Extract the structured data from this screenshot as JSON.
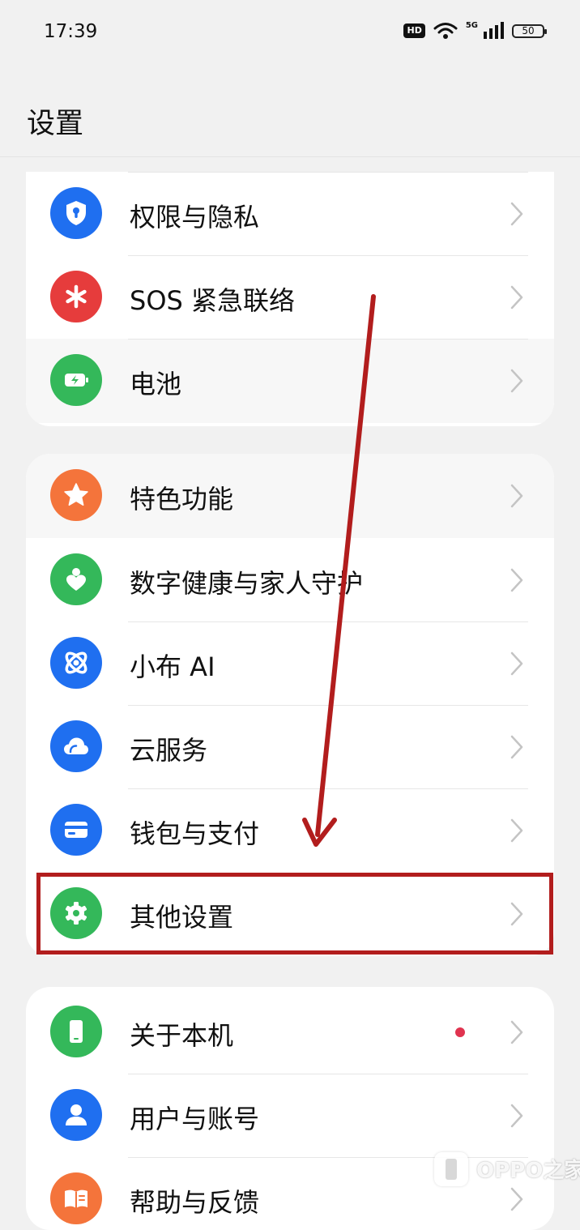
{
  "status_bar": {
    "time": "17:39",
    "hd_badge": "HD",
    "network": "5G",
    "battery_level": "50"
  },
  "header": {
    "title": "设置"
  },
  "groups": [
    {
      "items": [
        {
          "label": "权限与隐私",
          "icon": "shield-lock-icon",
          "color": "#1f6ff0"
        },
        {
          "label": "SOS 紧急联络",
          "icon": "sos-asterisk-icon",
          "color": "#e63c3c"
        },
        {
          "label": "电池",
          "icon": "battery-charging-icon",
          "color": "#34b85a"
        }
      ]
    },
    {
      "items": [
        {
          "label": "特色功能",
          "icon": "star-icon",
          "color": "#f4743b"
        },
        {
          "label": "数字健康与家人守护",
          "icon": "heart-person-icon",
          "color": "#34b85a"
        },
        {
          "label": "小布 AI",
          "icon": "ai-orbit-icon",
          "color": "#1f6ff0"
        },
        {
          "label": "云服务",
          "icon": "cloud-icon",
          "color": "#1f6ff0"
        },
        {
          "label": "钱包与支付",
          "icon": "wallet-card-icon",
          "color": "#1f6ff0"
        },
        {
          "label": "其他设置",
          "icon": "gear-icon",
          "color": "#34b85a"
        }
      ]
    },
    {
      "items": [
        {
          "label": "关于本机",
          "icon": "phone-icon",
          "color": "#34b85a",
          "badge_dot": true
        },
        {
          "label": "用户与账号",
          "icon": "user-icon",
          "color": "#1f6ff0"
        },
        {
          "label": "帮助与反馈",
          "icon": "book-help-icon",
          "color": "#f4743b"
        }
      ]
    }
  ],
  "annotation": {
    "highlight_color": "#b21d1d",
    "highlighted_item": "其他设置"
  },
  "watermark": {
    "text": "OPPO之家"
  }
}
